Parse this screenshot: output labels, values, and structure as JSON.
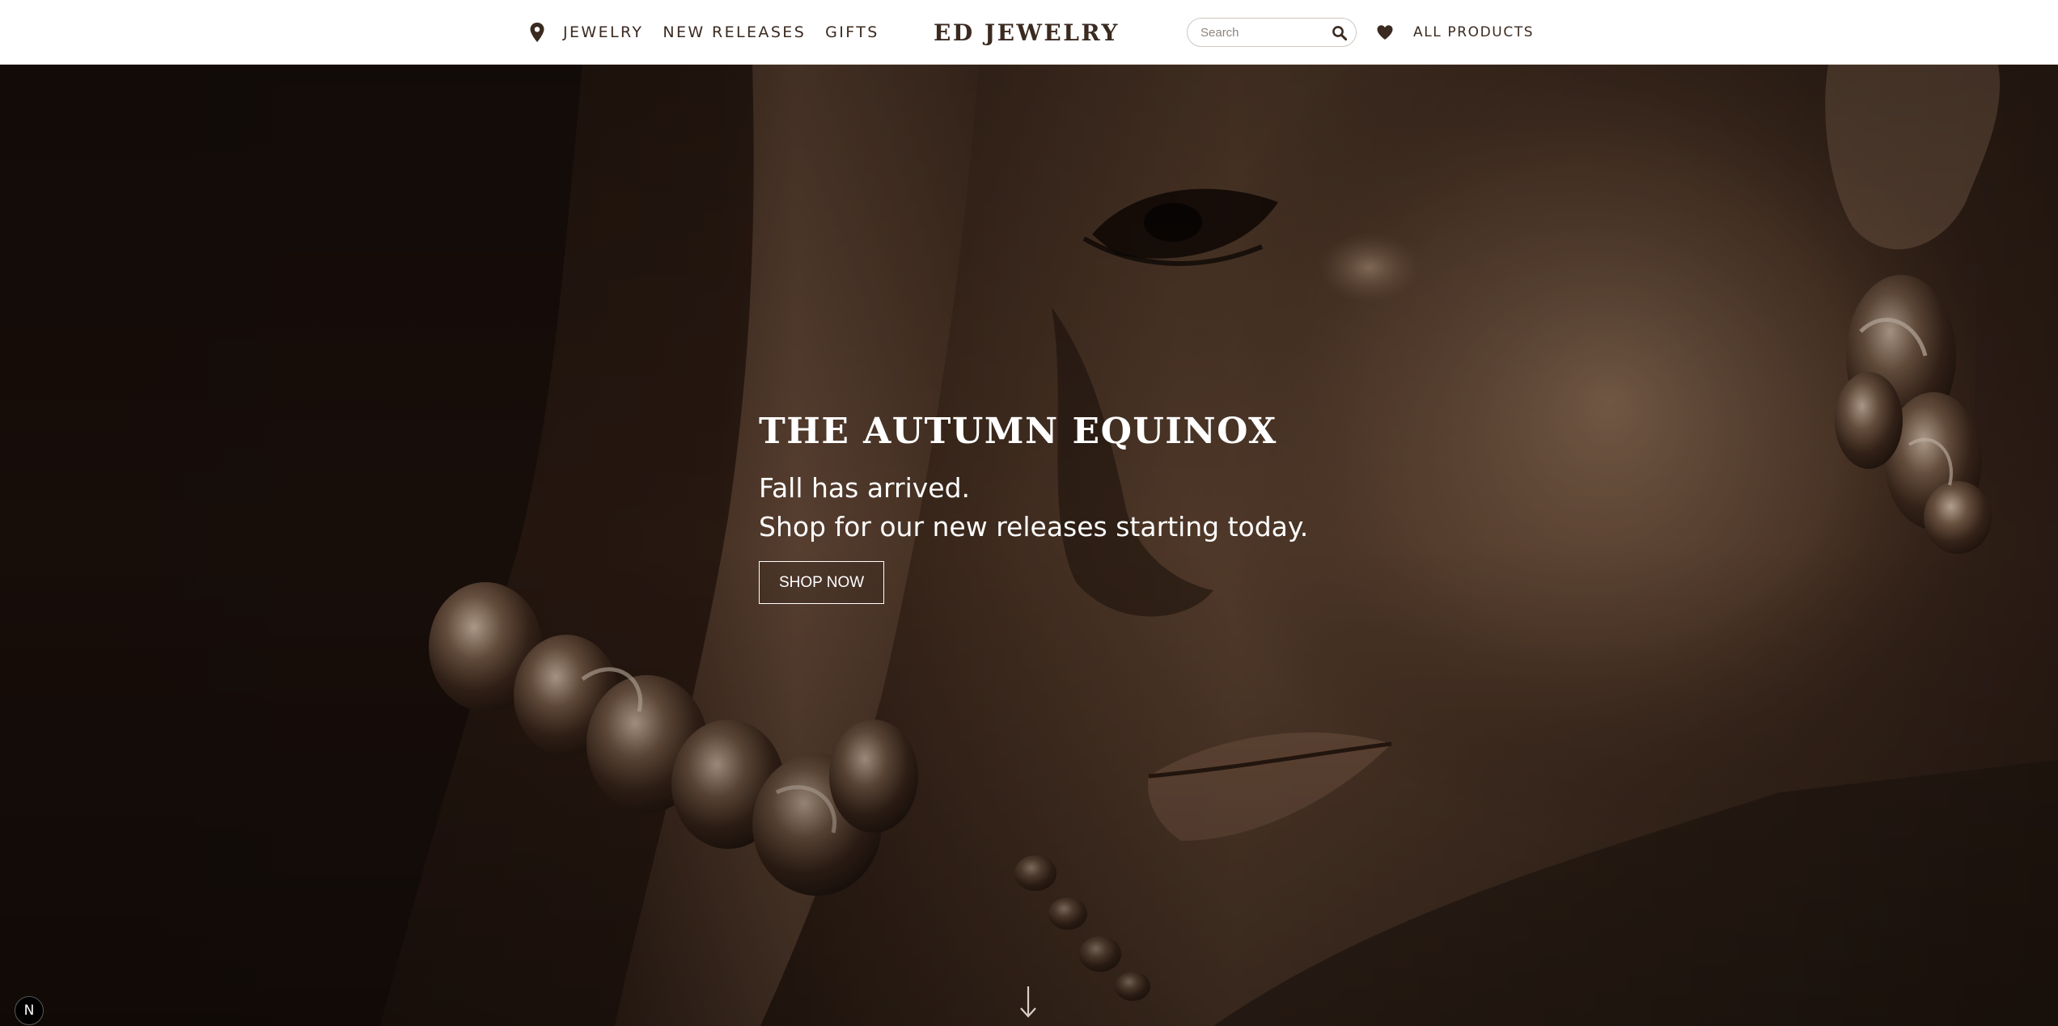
{
  "header": {
    "nav_links": [
      "JEWELRY",
      "NEW RELEASES",
      "GIFTS"
    ],
    "brand": "ED JEWELRY",
    "search_placeholder": "Search",
    "all_products_label": "ALL PRODUCTS",
    "icons": [
      "location-pin-icon",
      "search-icon",
      "heart-icon"
    ]
  },
  "hero": {
    "title": "THE AUTUMN EQUINOX",
    "line1": "Fall has arrived.",
    "line2": "Shop for our new releases starting today.",
    "cta_label": "SHOP NOW",
    "scroll_icon": "arrow-down-icon",
    "badge_letter": "N"
  },
  "colors": {
    "header_bg": "#ffffff",
    "header_text": "#3b2a20",
    "hero_overlay": "#1a100b",
    "hero_text": "#ffffff"
  }
}
